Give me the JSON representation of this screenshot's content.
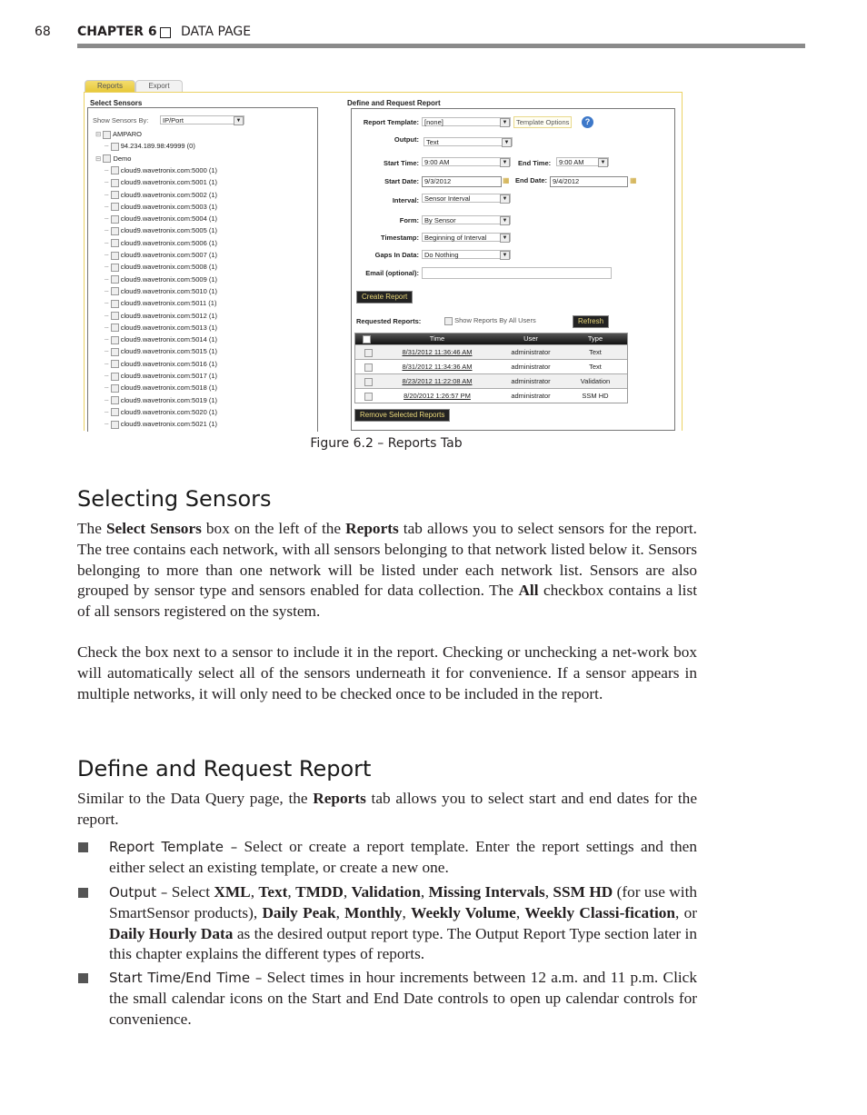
{
  "header": {
    "page_number": "68",
    "chapter": "CHAPTER 6",
    "section": "DATA PAGE"
  },
  "figure": {
    "tabs": [
      "Reports",
      "Export"
    ],
    "select_sensors": {
      "title": "Select Sensors",
      "show_by_label": "Show Sensors By:",
      "show_by_value": "IP/Port",
      "tree": [
        {
          "label": "AMPARO",
          "level": 0
        },
        {
          "label": "94.234.189.98:49999 (0)",
          "level": 1
        },
        {
          "label": "Demo",
          "level": 0
        },
        {
          "label": "cloud9.wavetronix.com:5000 (1)",
          "level": 1
        },
        {
          "label": "cloud9.wavetronix.com:5001 (1)",
          "level": 1
        },
        {
          "label": "cloud9.wavetronix.com:5002 (1)",
          "level": 1
        },
        {
          "label": "cloud9.wavetronix.com:5003 (1)",
          "level": 1
        },
        {
          "label": "cloud9.wavetronix.com:5004 (1)",
          "level": 1
        },
        {
          "label": "cloud9.wavetronix.com:5005 (1)",
          "level": 1
        },
        {
          "label": "cloud9.wavetronix.com:5006 (1)",
          "level": 1
        },
        {
          "label": "cloud9.wavetronix.com:5007 (1)",
          "level": 1
        },
        {
          "label": "cloud9.wavetronix.com:5008 (1)",
          "level": 1
        },
        {
          "label": "cloud9.wavetronix.com:5009 (1)",
          "level": 1
        },
        {
          "label": "cloud9.wavetronix.com:5010 (1)",
          "level": 1
        },
        {
          "label": "cloud9.wavetronix.com:5011 (1)",
          "level": 1
        },
        {
          "label": "cloud9.wavetronix.com:5012 (1)",
          "level": 1
        },
        {
          "label": "cloud9.wavetronix.com:5013 (1)",
          "level": 1
        },
        {
          "label": "cloud9.wavetronix.com:5014 (1)",
          "level": 1
        },
        {
          "label": "cloud9.wavetronix.com:5015 (1)",
          "level": 1
        },
        {
          "label": "cloud9.wavetronix.com:5016 (1)",
          "level": 1
        },
        {
          "label": "cloud9.wavetronix.com:5017 (1)",
          "level": 1
        },
        {
          "label": "cloud9.wavetronix.com:5018 (1)",
          "level": 1
        },
        {
          "label": "cloud9.wavetronix.com:5019 (1)",
          "level": 1
        },
        {
          "label": "cloud9.wavetronix.com:5020 (1)",
          "level": 1
        },
        {
          "label": "cloud9.wavetronix.com:5021 (1)",
          "level": 1
        }
      ]
    },
    "define": {
      "title": "Define and Request Report",
      "report_template_label": "Report Template:",
      "report_template": "[none]",
      "template_options": "Template Options",
      "output_label": "Output:",
      "output": "Text",
      "start_time_label": "Start Time:",
      "start_time": "9:00 AM",
      "end_time_label": "End Time:",
      "end_time": "9:00 AM",
      "start_date_label": "Start Date:",
      "start_date": "9/3/2012",
      "end_date_label": "End Date:",
      "end_date": "9/4/2012",
      "interval_label": "Interval:",
      "interval": "Sensor Interval",
      "form_label": "Form:",
      "form": "By Sensor",
      "timestamp_label": "Timestamp:",
      "timestamp": "Beginning of Interval",
      "gaps_label": "Gaps In Data:",
      "gaps": "Do Nothing",
      "email_label": "Email (optional):",
      "email": "",
      "create_report": "Create Report",
      "requested_reports_label": "Requested Reports:",
      "show_all_users": "Show Reports By All Users",
      "refresh": "Refresh",
      "columns": [
        "Time",
        "User",
        "Type"
      ],
      "rows": [
        {
          "time": "8/31/2012 11:36:46 AM",
          "user": "administrator",
          "type": "Text"
        },
        {
          "time": "8/31/2012 11:34:36 AM",
          "user": "administrator",
          "type": "Text"
        },
        {
          "time": "8/23/2012 11:22:08 AM",
          "user": "administrator",
          "type": "Validation"
        },
        {
          "time": "8/20/2012 1:26:57 PM",
          "user": "administrator",
          "type": "SSM HD"
        }
      ],
      "remove_selected": "Remove Selected Reports"
    },
    "caption": "Figure 6.2 – Reports Tab"
  },
  "sections": {
    "selecting_title": "Selecting Sensors",
    "define_title": "Define and Request Report"
  },
  "paragraphs": [
    [
      {
        "t": "The "
      },
      {
        "t": "Select Sensors",
        "b": 1
      },
      {
        "t": " box on the left of the "
      },
      {
        "t": "Reports",
        "b": 1
      },
      {
        "t": " tab allows you to select sensors for the report. The tree contains each network, with all sensors belonging to that network listed below it. Sensors belonging to more than one network will be listed under each network list. Sensors are also grouped by sensor type and sensors enabled for data collection. The "
      },
      {
        "t": "All",
        "b": 1
      },
      {
        "t": " checkbox contains a list of all sensors registered on the system."
      }
    ],
    [
      {
        "t": "Check the box next to a sensor to include it in the report. Checking or unchecking a net-work box will automatically select all of the sensors underneath it for convenience. If a sensor appears in multiple networks, it will only need to be checked once to be included in the report."
      }
    ],
    [
      {
        "t": "Similar to the Data Query page, the "
      },
      {
        "t": "Reports",
        "b": 1
      },
      {
        "t": " tab allows you to select start and end dates for the report."
      }
    ]
  ],
  "bullets": [
    [
      {
        "t": "Report Template –",
        "s": 1
      },
      {
        "t": " Select or create a report template. Enter the report settings and then either select an existing template, or create a new one."
      }
    ],
    [
      {
        "t": "Output –",
        "s": 1
      },
      {
        "t": " Select "
      },
      {
        "t": "XML",
        "b": 1
      },
      {
        "t": ", "
      },
      {
        "t": "Text",
        "b": 1
      },
      {
        "t": ", "
      },
      {
        "t": "TMDD",
        "b": 1
      },
      {
        "t": ", "
      },
      {
        "t": "Validation",
        "b": 1
      },
      {
        "t": ", "
      },
      {
        "t": "Missing Intervals",
        "b": 1
      },
      {
        "t": ", "
      },
      {
        "t": "SSM HD",
        "b": 1
      },
      {
        "t": " (for use with SmartSensor products), "
      },
      {
        "t": "Daily Peak",
        "b": 1
      },
      {
        "t": ", "
      },
      {
        "t": "Monthly",
        "b": 1
      },
      {
        "t": ", "
      },
      {
        "t": "Weekly Volume",
        "b": 1
      },
      {
        "t": ", "
      },
      {
        "t": "Weekly Classi-fication",
        "b": 1
      },
      {
        "t": ", or "
      },
      {
        "t": "Daily Hourly Data",
        "b": 1
      },
      {
        "t": " as the desired output report type. The Output Report Type section later in this chapter explains the different types of reports."
      }
    ],
    [
      {
        "t": "Start Time/End Time –",
        "s": 1
      },
      {
        "t": " Select times in hour increments between 12 a.m. and 11 p.m. Click the small calendar icons on the Start and End Date controls to open up calendar controls for convenience."
      }
    ]
  ]
}
